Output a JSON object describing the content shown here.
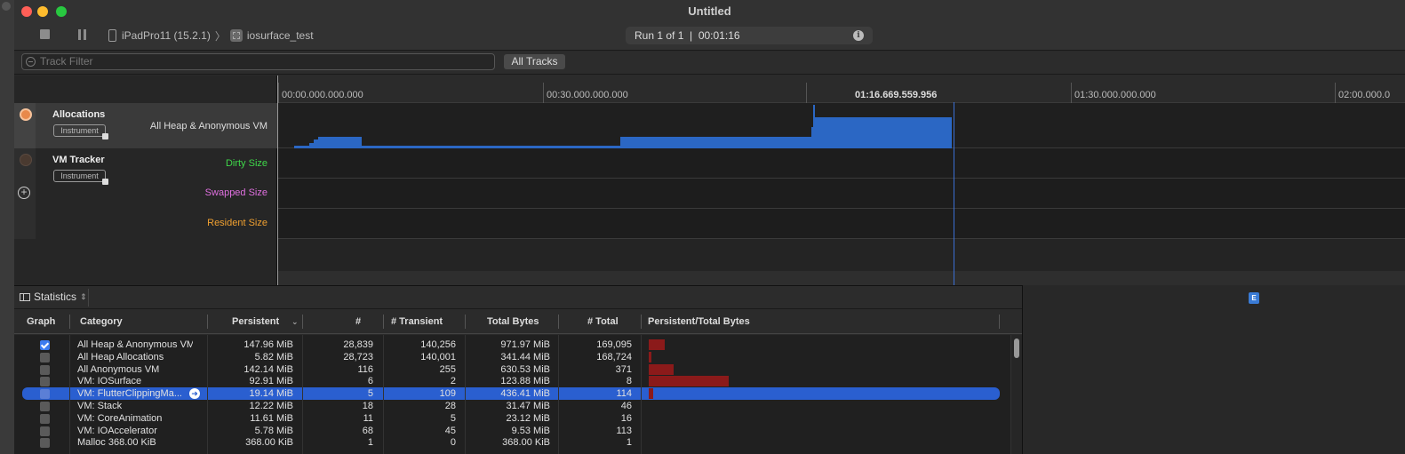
{
  "window": {
    "title": "Untitled"
  },
  "toolbar": {
    "device": "iPadPro11 (15.2.1)",
    "app": "iosurface_test",
    "run_status": "Run 1 of 1  |  00:01:16"
  },
  "filter": {
    "placeholder": "Track Filter",
    "all_tracks": "All Tracks"
  },
  "ruler": {
    "ticks": [
      "00:00.000.000.000",
      "00:30.000.000.000",
      "01:16.669.559.956",
      "01:30.000.000.000",
      "02:00.000.0"
    ]
  },
  "tracks": {
    "allocations": {
      "name": "Allocations",
      "badge": "Instrument",
      "label": "All Heap & Anonymous VM"
    },
    "vm_tracker": {
      "name": "VM Tracker",
      "badge": "Instrument",
      "labels": [
        "Dirty Size",
        "Swapped Size",
        "Resident Size"
      ]
    }
  },
  "stats": {
    "label": "Statistics",
    "badge": "E"
  },
  "table": {
    "headers": [
      "Graph",
      "Category",
      "Persistent",
      "#",
      "# Transient",
      "Total Bytes",
      "# Total",
      "Persistent/Total Bytes"
    ],
    "rows": [
      {
        "checked": true,
        "category": "All Heap & Anonymous VM",
        "persistent": "147.96 MiB",
        "count": "28,839",
        "transient": "140,256",
        "total_bytes": "971.97 MiB",
        "total": "169,095",
        "ratio": 0.15
      },
      {
        "checked": false,
        "category": "All Heap Allocations",
        "persistent": "5.82 MiB",
        "count": "28,723",
        "transient": "140,001",
        "total_bytes": "341.44 MiB",
        "total": "168,724",
        "ratio": 0.02
      },
      {
        "checked": false,
        "category": "All Anonymous VM",
        "persistent": "142.14 MiB",
        "count": "116",
        "transient": "255",
        "total_bytes": "630.53 MiB",
        "total": "371",
        "ratio": 0.23
      },
      {
        "checked": false,
        "category": "VM: IOSurface",
        "persistent": "92.91 MiB",
        "count": "6",
        "transient": "2",
        "total_bytes": "123.88 MiB",
        "total": "8",
        "ratio": 0.75
      },
      {
        "checked": false,
        "category": "VM: FlutterClippingMa...",
        "persistent": "19.14 MiB",
        "count": "5",
        "transient": "109",
        "total_bytes": "436.41 MiB",
        "total": "114",
        "ratio": 0.04,
        "selected": true
      },
      {
        "checked": false,
        "category": "VM: Stack",
        "persistent": "12.22 MiB",
        "count": "18",
        "transient": "28",
        "total_bytes": "31.47 MiB",
        "total": "46",
        "ratio": 0
      },
      {
        "checked": false,
        "category": "VM: CoreAnimation",
        "persistent": "11.61 MiB",
        "count": "11",
        "transient": "5",
        "total_bytes": "23.12 MiB",
        "total": "16",
        "ratio": 0
      },
      {
        "checked": false,
        "category": "VM: IOAccelerator",
        "persistent": "5.78 MiB",
        "count": "68",
        "transient": "45",
        "total_bytes": "9.53 MiB",
        "total": "113",
        "ratio": 0
      },
      {
        "checked": false,
        "category": "Malloc 368.00 KiB",
        "persistent": "368.00 KiB",
        "count": "1",
        "transient": "0",
        "total_bytes": "368.00 KiB",
        "total": "1",
        "ratio": 0
      }
    ]
  },
  "colors": {
    "accent": "#2a5fd0",
    "alloc_graph": "#2b67c4",
    "dirty": "#3fd84a",
    "swapped": "#e070e0",
    "resident": "#f0a030"
  }
}
